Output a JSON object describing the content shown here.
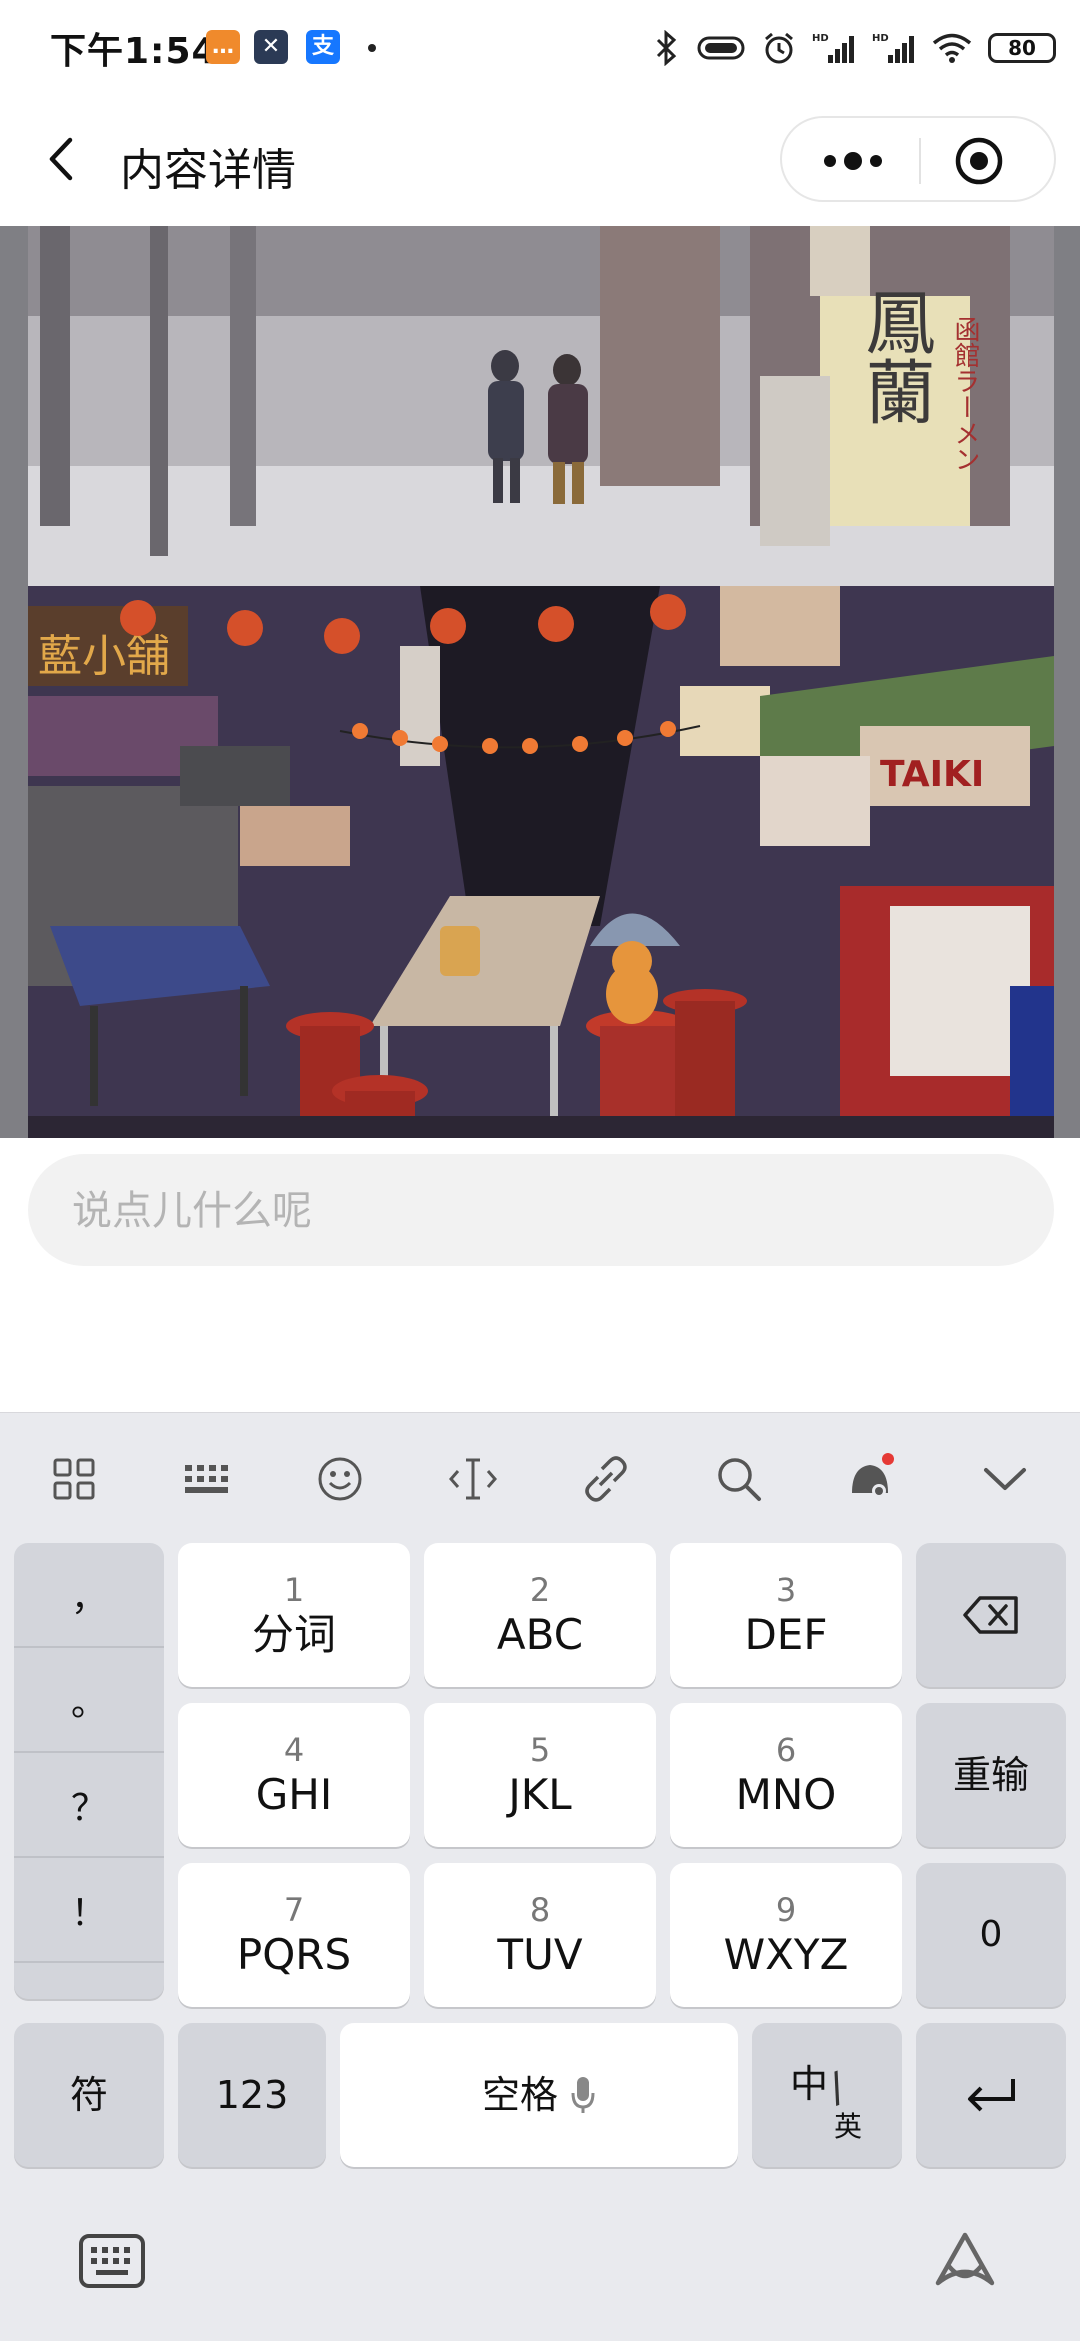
{
  "status_bar": {
    "time": "下午1:54",
    "battery": "80",
    "app_icons": [
      "chat-app-icon",
      "capcut-icon",
      "alipay-icon"
    ],
    "indicators": [
      "bluetooth-icon",
      "vibrate-icon",
      "alarm-icon",
      "hd-signal-icon",
      "hd-signal-icon",
      "wifi-icon"
    ]
  },
  "nav": {
    "title": "内容详情"
  },
  "photo": {
    "top_sign_1": "鳳蘭",
    "top_sign_2": "函館ラーメン",
    "shop_sign": "藍小舗",
    "sign_taiki": "TAIKI"
  },
  "comment": {
    "placeholder": "说点儿什么呢"
  },
  "keyboard": {
    "toolbar": [
      "grid-icon",
      "keyboard-icon",
      "emoji-icon",
      "cursor-icon",
      "link-icon",
      "search-icon",
      "assistant-icon",
      "collapse-icon"
    ],
    "punctuation": [
      "，",
      "。",
      "？",
      "！",
      ""
    ],
    "keys": [
      {
        "num": "1",
        "label": "分词"
      },
      {
        "num": "2",
        "label": "ABC"
      },
      {
        "num": "3",
        "label": "DEF"
      },
      {
        "num": "4",
        "label": "GHI"
      },
      {
        "num": "5",
        "label": "JKL"
      },
      {
        "num": "6",
        "label": "MNO"
      },
      {
        "num": "7",
        "label": "PQRS"
      },
      {
        "num": "8",
        "label": "TUV"
      },
      {
        "num": "9",
        "label": "WXYZ"
      }
    ],
    "reenter": "重输",
    "zero": "0",
    "symbols": "符",
    "numbers": "123",
    "space": "空格",
    "lang_main": "中",
    "lang_sub": "英"
  }
}
